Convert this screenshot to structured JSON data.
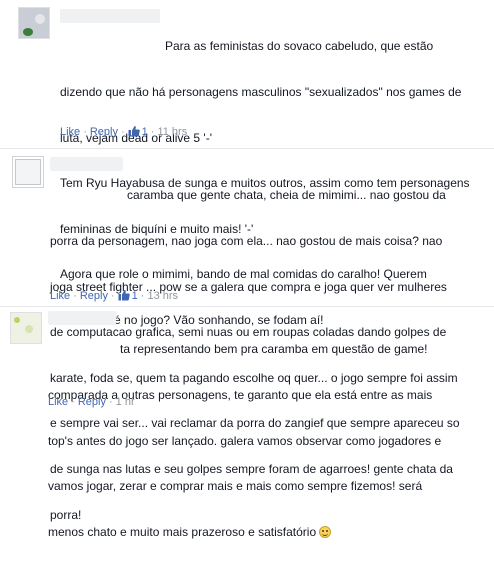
{
  "comments": [
    {
      "lines": [
        "Para as feministas do sovaco cabeludo, que estão",
        "dizendo que não há personagens masculinos \"sexualizados\" nos games de",
        "luta, vejam dead or alive 5 '-'",
        "Tem Ryu Hayabusa de sunga e muitos outros, assim como tem personagens",
        "femininas de biquíni e muito mais! '-'",
        "Agora que role o mimimi, bando de mal comidas do caralho! Querem",
        "mandar até no jogo? Vão sonhando, se fodam aí!"
      ],
      "like_label": "Like",
      "reply_label": "Reply",
      "like_count": "1",
      "time": "11 hrs"
    },
    {
      "lines": [
        "caramba que gente chata, cheia de mimimi... nao gostou da",
        "porra da personagem, nao joga com ela... nao gostou de mais coisa? nao",
        "joga street fighter ... pow se a galera que compra e joga quer ver mulheres",
        "de computacao grafica, semi nuas ou em roupas coladas dando golpes de",
        "karate, foda se, quem ta pagando escolhe oq quer... o jogo sempre foi assim",
        "e sempre vai ser... vai reclamar da porra do zangief que sempre apareceu so",
        "de sunga nas lutas e seu golpes sempre foram de agarroes! gente chata da",
        "porra!"
      ],
      "like_label": "Like",
      "reply_label": "Reply",
      "like_count": "1",
      "time": "13 hrs"
    },
    {
      "lines": [
        "ta representando bem pra caramba em questão de game!",
        "comparada a outras personagens, te garanto que ela está entre as mais",
        "top's antes do jogo ser lançado. galera vamos observar como jogadores e",
        "vamos jogar, zerar e comprar mais e mais como sempre fizemos! será",
        "menos chato e muito mais prazeroso e satisfatório"
      ],
      "like_label": "Like",
      "reply_label": "Reply",
      "time": "1 hr"
    }
  ],
  "colors": {
    "link": "#4267b2",
    "meta": "#90949c",
    "text": "#141823"
  },
  "icons": {
    "like": "thumbs-up-icon",
    "smile": "smile-emoji-icon"
  }
}
